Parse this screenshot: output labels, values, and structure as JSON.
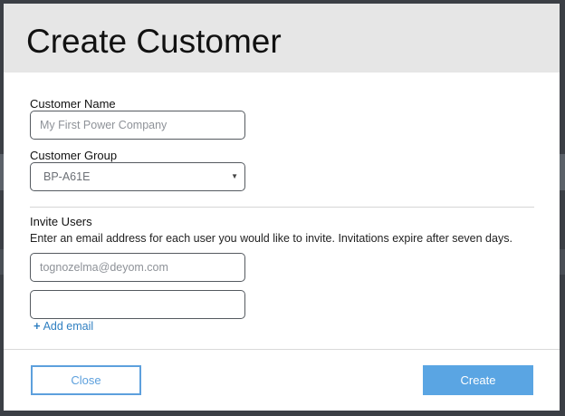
{
  "modal": {
    "title": "Create Customer"
  },
  "form": {
    "customer_name": {
      "label": "Customer Name",
      "placeholder": "My First Power Company",
      "value": ""
    },
    "customer_group": {
      "label": "Customer Group",
      "selected": "BP-A61E",
      "caret": "▼"
    },
    "invite_users": {
      "label": "Invite Users",
      "help_text": "Enter an email address for each user you would like to invite. Invitations expire after seven days.",
      "emails": [
        {
          "placeholder": "tognozelma@deyom.com",
          "value": ""
        },
        {
          "placeholder": "",
          "value": ""
        }
      ],
      "add_email_label": "Add email",
      "add_email_icon": "+"
    }
  },
  "footer": {
    "close_label": "Close",
    "create_label": "Create"
  },
  "colors": {
    "header_bg": "#e6e6e6",
    "accent": "#5aa5e3",
    "link": "#2f7fc1"
  }
}
